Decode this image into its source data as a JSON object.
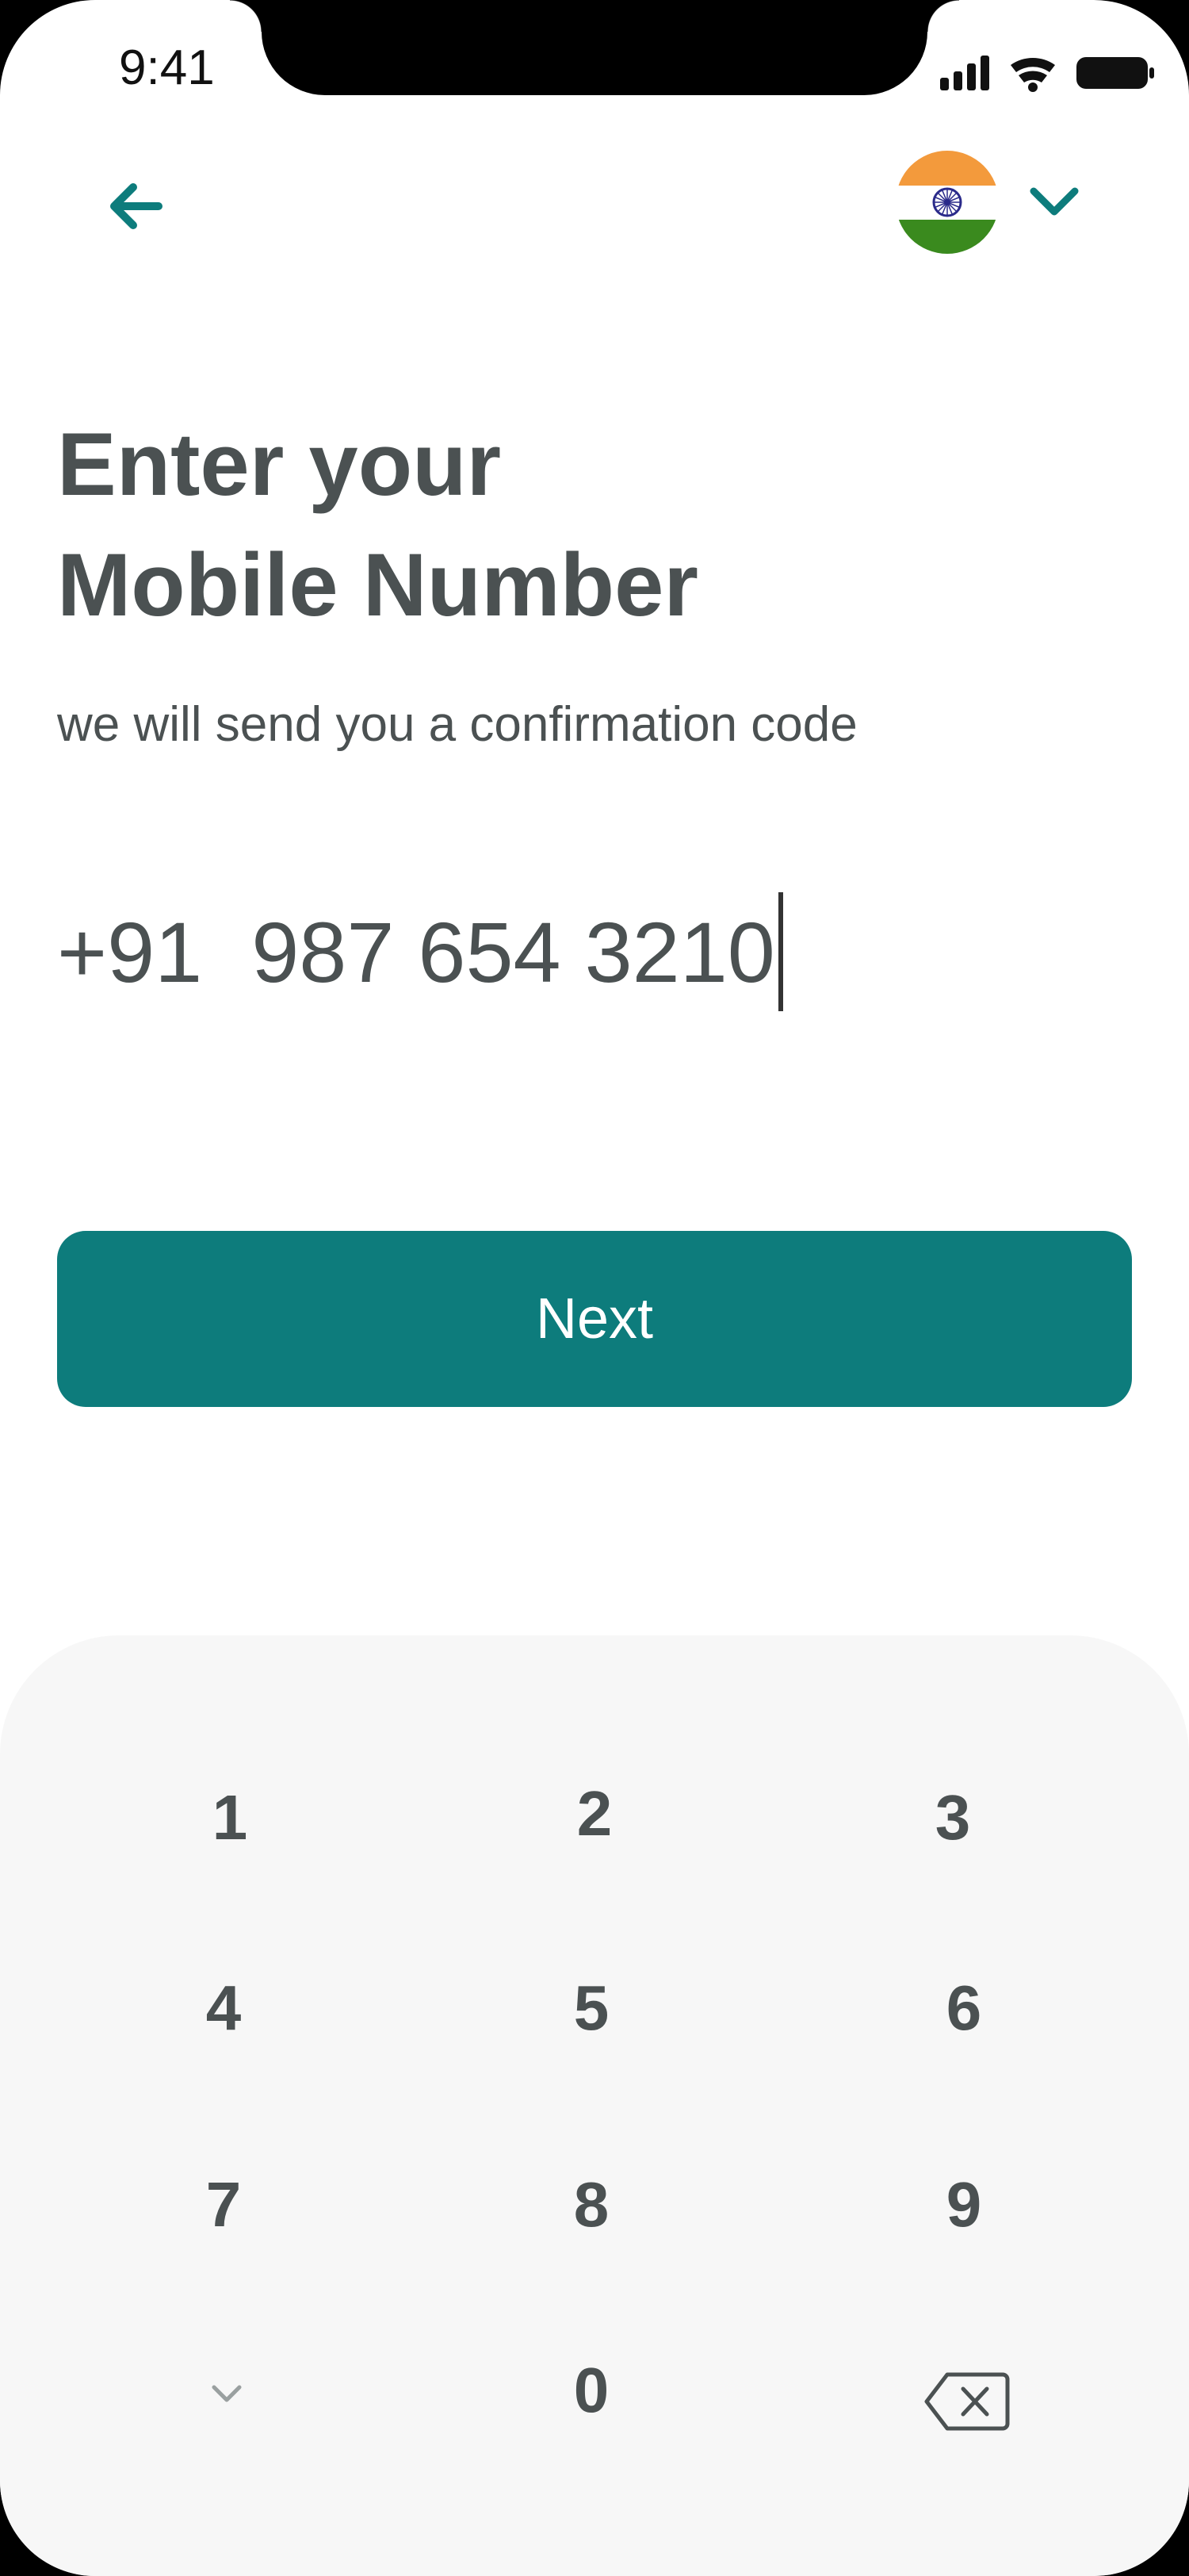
{
  "status_bar": {
    "time": "9:41",
    "icons": [
      "cellular-signal-icon",
      "wifi-icon",
      "battery-icon"
    ]
  },
  "header": {
    "back_icon": "arrow-left-icon",
    "country_flag": "india-flag-icon",
    "dropdown_icon": "chevron-down-icon"
  },
  "title": {
    "line1": "Enter your",
    "line2": "Mobile Number"
  },
  "subtitle": "we will send you a confirmation code",
  "phone_input": {
    "country_code": "+91",
    "value": "987 654 3210"
  },
  "next_button": {
    "label": "Next"
  },
  "keypad": {
    "keys": [
      "1",
      "2",
      "3",
      "4",
      "5",
      "6",
      "7",
      "8",
      "9",
      "0"
    ],
    "hide_icon": "chevron-down-icon",
    "backspace_icon": "backspace-icon"
  },
  "colors": {
    "accent": "#0d7c7c",
    "text": "#4b5152",
    "keypad_bg": "#f7f7f7",
    "flag_saffron": "#f39a3c",
    "flag_green": "#3a8a1e",
    "flag_chakra": "#2a2a8a"
  }
}
